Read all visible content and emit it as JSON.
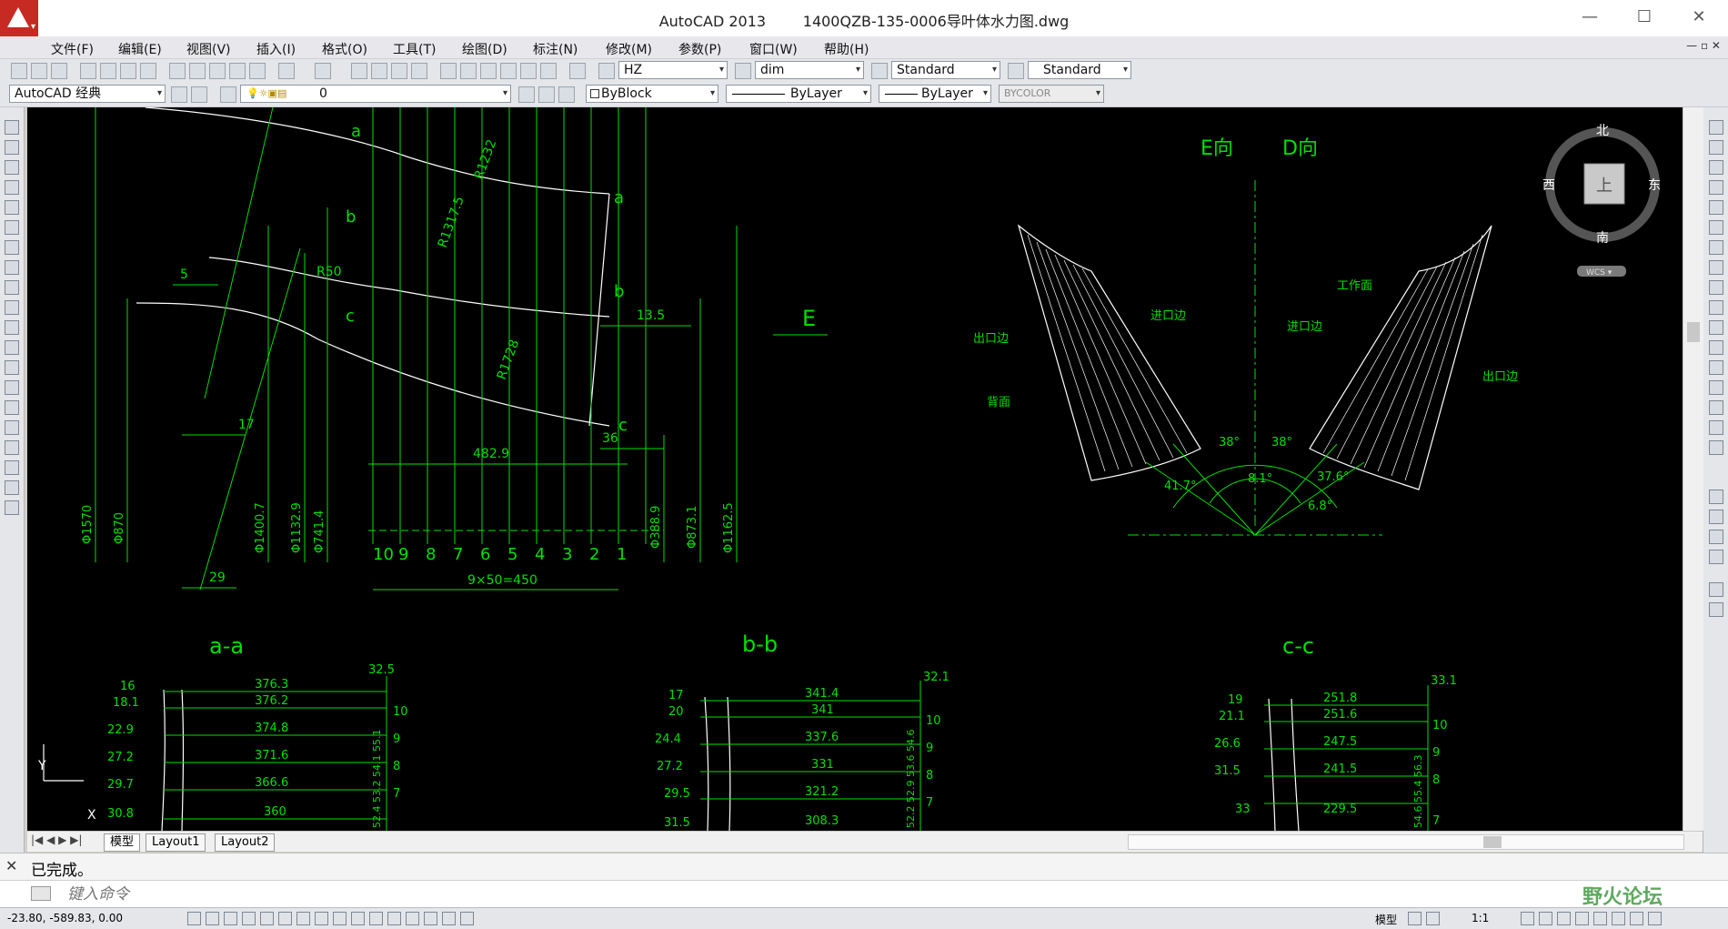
{
  "window": {
    "app_name": "AutoCAD 2013",
    "file_name": "1400QZB-135-0006导叶体水力图.dwg",
    "minimize": "—",
    "maximize": "☐",
    "close": "✕"
  },
  "menu": [
    "文件(F)",
    "编辑(E)",
    "视图(V)",
    "插入(I)",
    "格式(O)",
    "工具(T)",
    "绘图(D)",
    "标注(N)",
    "修改(M)",
    "参数(P)",
    "窗口(W)",
    "帮助(H)"
  ],
  "toolbar": {
    "text_style": "HZ",
    "dim_style": "dim",
    "table_style": "Standard",
    "mleader_style": "Standard",
    "workspace": "AutoCAD 经典",
    "layer": "0",
    "color": "ByBlock",
    "linetype": "ByLayer",
    "lineweight": "ByLayer",
    "plotstyle": "BYCOLOR"
  },
  "viewcube": {
    "north": "北",
    "south": "南",
    "east": "东",
    "west": "西",
    "face": "上",
    "wcs": "WCS ▾"
  },
  "drawing": {
    "top_view": {
      "points": [
        "a",
        "b",
        "c",
        "a",
        "b",
        "c"
      ],
      "radii": [
        "R1232",
        "R1317.5",
        "R1728",
        "R50"
      ],
      "dims_h": [
        "5",
        "17",
        "29",
        "482.9",
        "36",
        "13.5"
      ],
      "stations": [
        "10",
        "9",
        "8",
        "7",
        "6",
        "5",
        "4",
        "3",
        "2",
        "1"
      ],
      "station_dim": "9×50=450",
      "diameters": [
        "Φ1570",
        "Φ870",
        "Φ1400.7",
        "Φ1132.9",
        "Φ741.4",
        "Φ388.9",
        "Φ873.1",
        "Φ1162.5"
      ],
      "arrow_label": "E"
    },
    "views": {
      "e_view": "E向",
      "d_view": "D向",
      "labels": [
        "出口边",
        "背面",
        "进口边",
        "工作面",
        "进口边",
        "出口边"
      ],
      "angles": [
        "41.7°",
        "38°",
        "38°",
        "8.1°",
        "37.6°",
        "6.8°"
      ]
    },
    "sections": [
      {
        "title": "a-a",
        "top_value": "32.5",
        "rows": [
          {
            "left": "16",
            "dim": "376.3",
            "station": ""
          },
          {
            "left": "18.1",
            "dim": "376.2",
            "station": "10"
          },
          {
            "left": "22.9",
            "dim": "374.8",
            "station": "9"
          },
          {
            "left": "27.2",
            "dim": "371.6",
            "station": "8"
          },
          {
            "left": "29.7",
            "dim": "366.6",
            "station": "7"
          },
          {
            "left": "30.8",
            "dim": "360",
            "station": ""
          }
        ],
        "vertical_values": "52.4 53.2 54.1 55.1"
      },
      {
        "title": "b-b",
        "top_value": "32.1",
        "rows": [
          {
            "left": "17",
            "dim": "341.4",
            "station": ""
          },
          {
            "left": "20",
            "dim": "341",
            "station": "10"
          },
          {
            "left": "24.4",
            "dim": "337.6",
            "station": "9"
          },
          {
            "left": "27.2",
            "dim": "331",
            "station": "8"
          },
          {
            "left": "29.5",
            "dim": "321.2",
            "station": "7"
          },
          {
            "left": "31.5",
            "dim": "308.3",
            "station": ""
          }
        ],
        "vertical_values": "52.2 52.9 53.6 54.6"
      },
      {
        "title": "c-c",
        "top_value": "33.1",
        "rows": [
          {
            "left": "19",
            "dim": "251.8",
            "station": ""
          },
          {
            "left": "21.1",
            "dim": "251.6",
            "station": "10"
          },
          {
            "left": "26.6",
            "dim": "247.5",
            "station": "9"
          },
          {
            "left": "31.5",
            "dim": "241.5",
            "station": "8"
          },
          {
            "left": "33",
            "dim": "229.5",
            "station": "7"
          }
        ],
        "vertical_values": "54.6 55.4 56.3"
      }
    ],
    "ucs_x": "X",
    "ucs_y": "Y"
  },
  "layout_tabs": [
    "模型",
    "Layout1",
    "Layout2"
  ],
  "command": {
    "history": "已完成。",
    "placeholder": "键入命令",
    "close": "✕"
  },
  "status": {
    "coordinates": "-23.80, -589.83, 0.00",
    "model_label": "模型",
    "scale": "1:1"
  },
  "watermark": "野火论坛"
}
